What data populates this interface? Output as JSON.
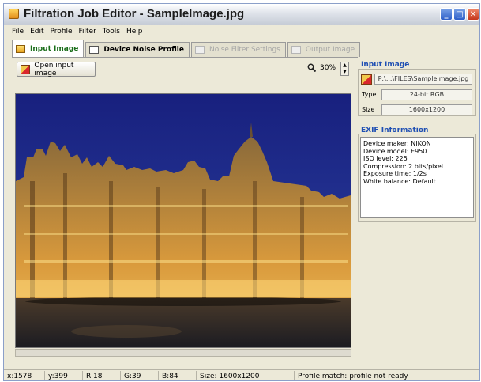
{
  "window": {
    "title": "Filtration Job Editor - SampleImage.jpg",
    "minimize_glyph": "_",
    "maximize_glyph": "□",
    "close_glyph": "✕"
  },
  "menu": {
    "items": [
      "File",
      "Edit",
      "Profile",
      "Filter",
      "Tools",
      "Help"
    ]
  },
  "tabs": [
    {
      "label": "Input Image",
      "state": "active"
    },
    {
      "label": "Device Noise Profile",
      "state": "enabled"
    },
    {
      "label": "Noise Filter Settings",
      "state": "disabled"
    },
    {
      "label": "Output Image",
      "state": "disabled"
    }
  ],
  "toolbar": {
    "open_button_label": "Open input image",
    "zoom_value": "30%",
    "spin_up_glyph": "▲",
    "spin_down_glyph": "▼"
  },
  "input_image": {
    "section_title": "Input Image",
    "path": "P:\\...\\FILES\\SampleImage.jpg",
    "type_label": "Type",
    "type_value": "24-bit RGB",
    "size_label": "Size",
    "size_value": "1600x1200"
  },
  "exif": {
    "section_title": "EXIF Information",
    "lines": [
      "Device maker: NIKON",
      "Device model: E950",
      "ISO level: 225",
      "Compression: 2 bits/pixel",
      "Exposure time: 1/2s",
      "White balance: Default"
    ]
  },
  "status": {
    "x": "x:1578",
    "y": "y:399",
    "r": "R:18",
    "g": "G:39",
    "b": "B:84",
    "size": "Size: 1600x1200",
    "profile": "Profile match: profile not ready"
  },
  "colors": {
    "sky_top": "#1a2384",
    "sky_bottom": "#2b3f9e",
    "building_lit": "#e0a040",
    "building_shadow": "#3a2616",
    "plaza": "#2a2a2e",
    "section_title": "#1f4fb3",
    "active_tab_text": "#1a6e1a"
  }
}
